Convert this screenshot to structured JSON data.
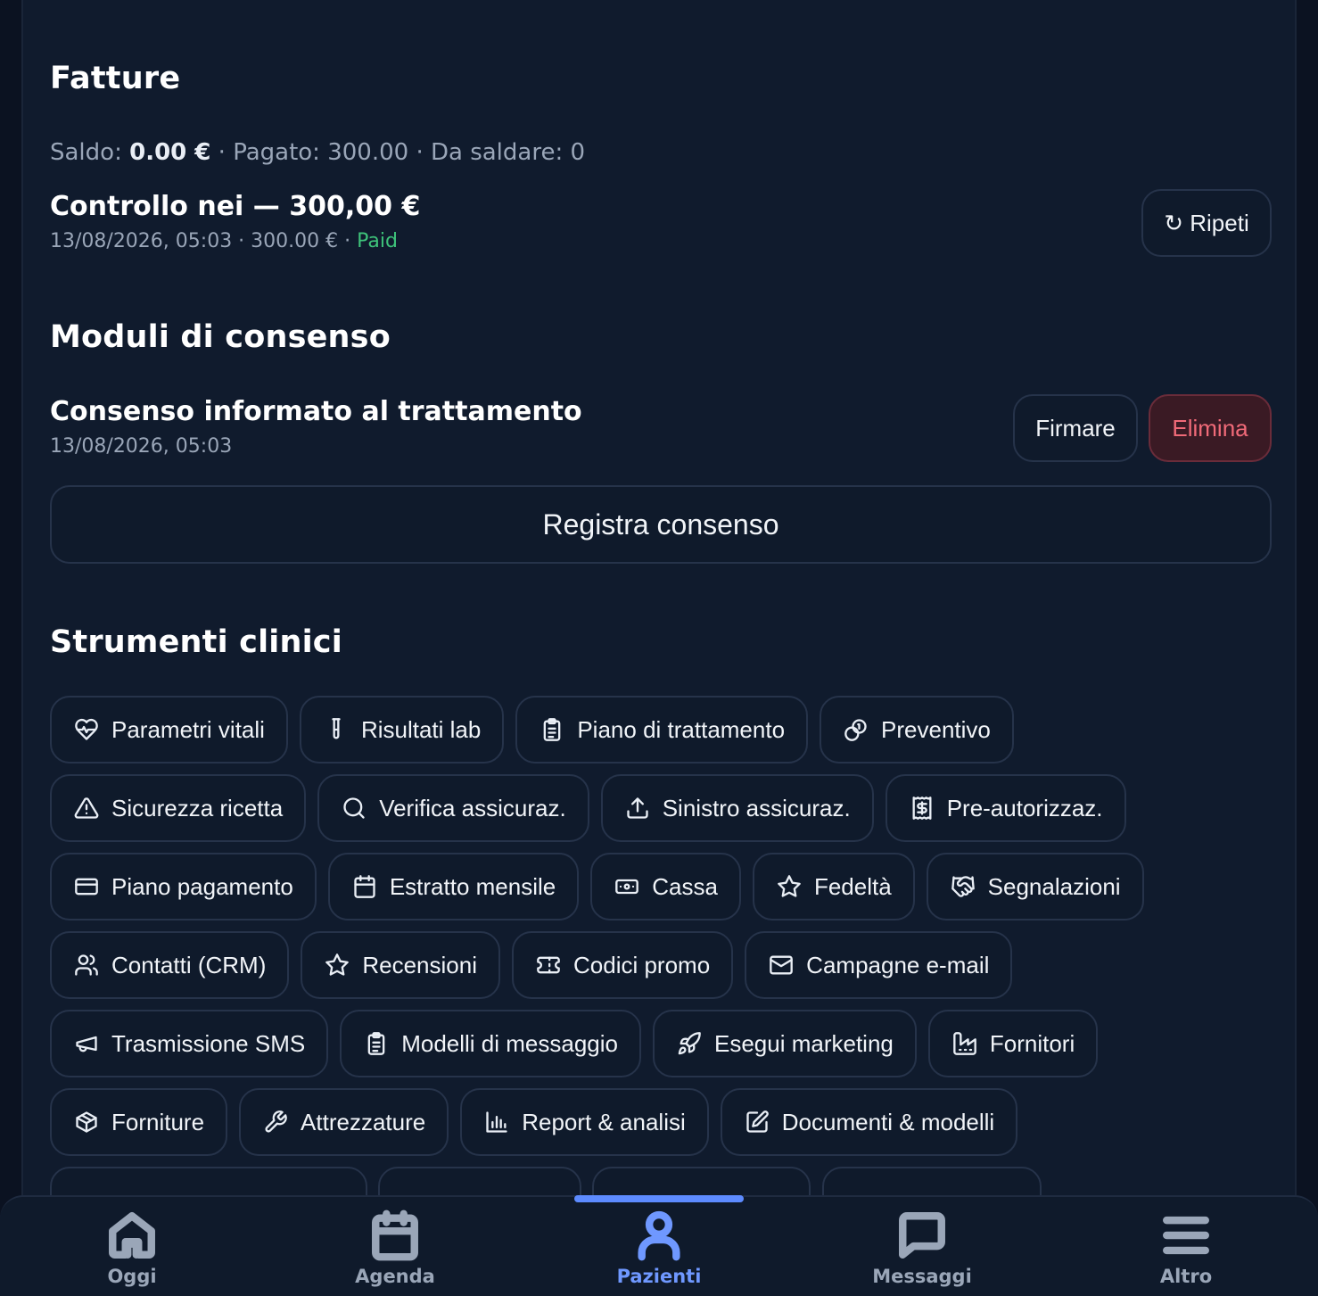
{
  "invoices": {
    "heading": "Fatture",
    "summary": {
      "balance_label": "Saldo:",
      "balance_value": "0.00 €",
      "paid_text": "Pagato: 300.00",
      "due_text": "Da saldare: 0",
      "sep": "·"
    },
    "item": {
      "title": "Controllo nei — 300,00 €",
      "meta": "13/08/2026, 05:03 · 300.00 € ·",
      "status": "Paid",
      "repeat_label": "↻ Ripeti"
    }
  },
  "consents": {
    "heading": "Moduli di consenso",
    "item": {
      "title": "Consenso informato al trattamento",
      "date": "13/08/2026, 05:03",
      "sign_label": "Firmare",
      "delete_label": "Elimina"
    },
    "register_label": "Registra consenso"
  },
  "tools": {
    "heading": "Strumenti clinici",
    "rows": [
      [
        {
          "label": "Parametri vitali",
          "icon": "heart-pulse-icon"
        },
        {
          "label": "Risultati lab",
          "icon": "test-tube-icon"
        },
        {
          "label": "Piano di trattamento",
          "icon": "clipboard-list-icon"
        },
        {
          "label": "Preventivo",
          "icon": "coins-icon"
        }
      ],
      [
        {
          "label": "Sicurezza ricetta",
          "icon": "warning-triangle-icon"
        },
        {
          "label": "Verifica assicuraz.",
          "icon": "search-icon"
        },
        {
          "label": "Sinistro assicuraz.",
          "icon": "upload-icon"
        },
        {
          "label": "Pre-autorizzaz.",
          "icon": "receipt-icon"
        }
      ],
      [
        {
          "label": "Piano pagamento",
          "icon": "credit-card-icon"
        },
        {
          "label": "Estratto mensile",
          "icon": "calendar-icon"
        },
        {
          "label": "Cassa",
          "icon": "banknote-icon"
        },
        {
          "label": "Fedeltà",
          "icon": "star-icon"
        },
        {
          "label": "Segnalazioni",
          "icon": "handshake-icon"
        }
      ],
      [
        {
          "label": "Contatti (CRM)",
          "icon": "users-icon"
        },
        {
          "label": "Recensioni",
          "icon": "star-icon"
        },
        {
          "label": "Codici promo",
          "icon": "ticket-icon"
        },
        {
          "label": "Campagne e-mail",
          "icon": "mail-icon"
        }
      ],
      [
        {
          "label": "Trasmissione SMS",
          "icon": "megaphone-icon"
        },
        {
          "label": "Modelli di messaggio",
          "icon": "clipboard-list-icon"
        },
        {
          "label": "Esegui marketing",
          "icon": "rocket-icon"
        },
        {
          "label": "Fornitori",
          "icon": "factory-icon"
        }
      ],
      [
        {
          "label": "Forniture",
          "icon": "package-icon"
        },
        {
          "label": "Attrezzature",
          "icon": "wrench-icon"
        },
        {
          "label": "Report & analisi",
          "icon": "bar-chart-icon"
        },
        {
          "label": "Documenti & modelli",
          "icon": "edit-icon"
        }
      ]
    ]
  },
  "nav": {
    "items": [
      {
        "label": "Oggi",
        "icon": "home-icon"
      },
      {
        "label": "Agenda",
        "icon": "calendar-icon"
      },
      {
        "label": "Pazienti",
        "icon": "user-icon",
        "active": true
      },
      {
        "label": "Messaggi",
        "icon": "message-icon"
      },
      {
        "label": "Altro",
        "icon": "menu-icon"
      }
    ],
    "active_color": "#6f98ff"
  }
}
